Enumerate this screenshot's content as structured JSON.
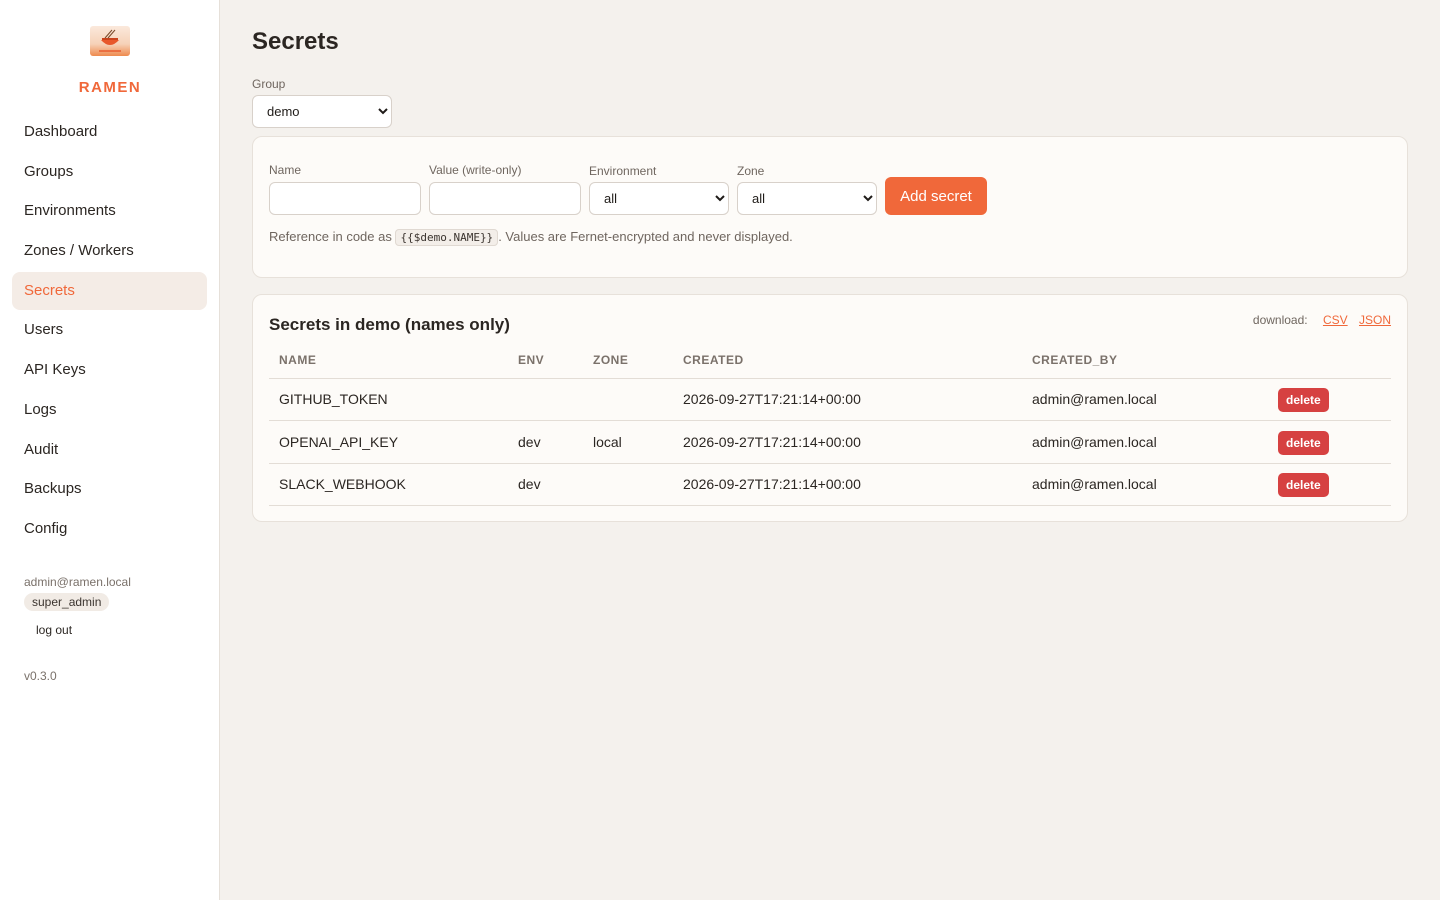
{
  "brand": {
    "name": "RAMEN"
  },
  "sidebar": {
    "items": [
      {
        "label": "Dashboard"
      },
      {
        "label": "Groups"
      },
      {
        "label": "Environments"
      },
      {
        "label": "Zones / Workers"
      },
      {
        "label": "Secrets",
        "active": true
      },
      {
        "label": "Users"
      },
      {
        "label": "API Keys"
      },
      {
        "label": "Logs"
      },
      {
        "label": "Audit"
      },
      {
        "label": "Backups"
      },
      {
        "label": "Config"
      }
    ],
    "user_email": "admin@ramen.local",
    "role": "super_admin",
    "logout_label": "log out",
    "version": "v0.3.0"
  },
  "page": {
    "title": "Secrets",
    "group_label": "Group",
    "group_value": "demo"
  },
  "form": {
    "name_label": "Name",
    "value_label": "Value (write-only)",
    "env_label": "Environment",
    "env_value": "all",
    "zone_label": "Zone",
    "zone_value": "all",
    "add_button": "Add secret",
    "hint_prefix": "Reference in code as ",
    "hint_code": "{{$demo.NAME}}",
    "hint_suffix": ". Values are Fernet-encrypted and never displayed."
  },
  "list": {
    "title": "Secrets in demo (names only)",
    "download_label": "download:",
    "csv_label": "CSV",
    "json_label": "JSON",
    "columns": [
      "NAME",
      "ENV",
      "ZONE",
      "CREATED",
      "CREATED_BY",
      ""
    ],
    "rows": [
      {
        "name": "GITHUB_TOKEN",
        "env": "",
        "zone": "",
        "created": "2026-09-27T17:21:14+00:00",
        "created_by": "admin@ramen.local",
        "action": "delete"
      },
      {
        "name": "OPENAI_API_KEY",
        "env": "dev",
        "zone": "local",
        "created": "2026-09-27T17:21:14+00:00",
        "created_by": "admin@ramen.local",
        "action": "delete"
      },
      {
        "name": "SLACK_WEBHOOK",
        "env": "dev",
        "zone": "",
        "created": "2026-09-27T17:21:14+00:00",
        "created_by": "admin@ramen.local",
        "action": "delete"
      }
    ]
  },
  "colors": {
    "accent": "#f0683a",
    "danger": "#d64141",
    "background": "#f4f1ed"
  }
}
